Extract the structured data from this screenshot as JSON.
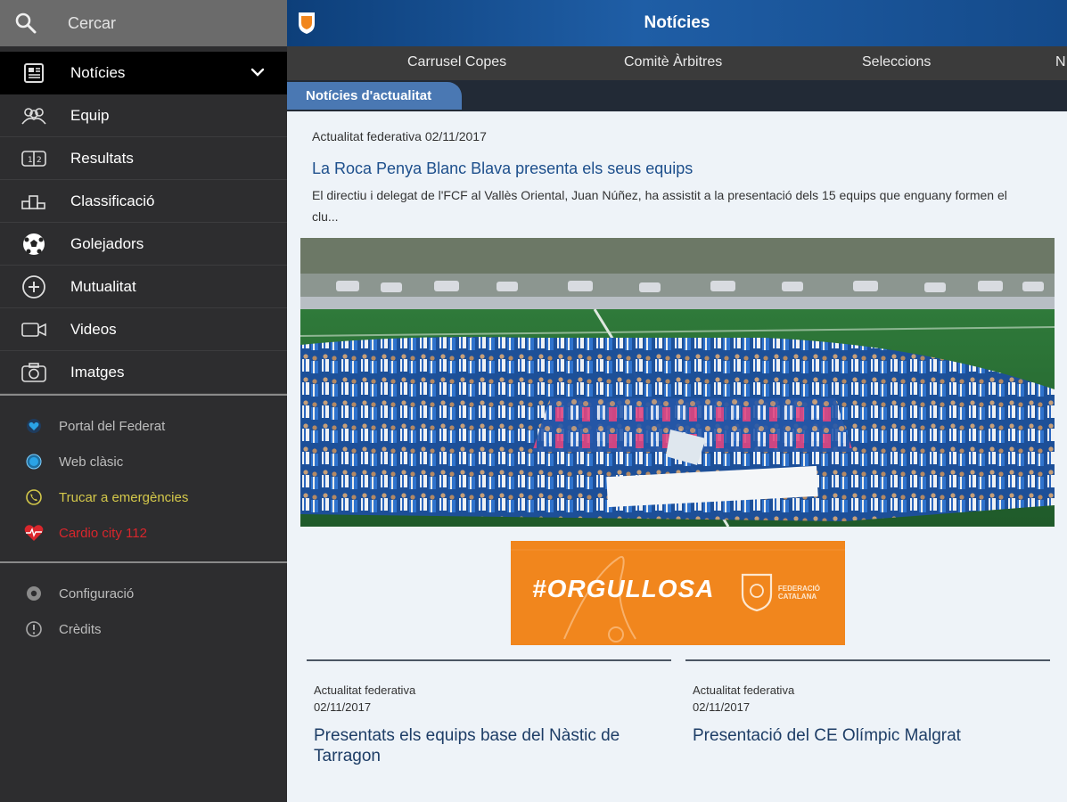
{
  "search": {
    "label": "Cercar"
  },
  "nav": {
    "items": [
      {
        "label": "Notícies",
        "icon": "newspaper-icon",
        "active": true
      },
      {
        "label": "Equip",
        "icon": "team-icon"
      },
      {
        "label": "Resultats",
        "icon": "scoreboard-icon"
      },
      {
        "label": "Classificació",
        "icon": "podium-icon"
      },
      {
        "label": "Golejadors",
        "icon": "soccer-ball-icon"
      },
      {
        "label": "Mutualitat",
        "icon": "plus-circle-icon"
      },
      {
        "label": "Videos",
        "icon": "video-camera-icon"
      },
      {
        "label": "Imatges",
        "icon": "camera-icon"
      }
    ]
  },
  "links": [
    {
      "label": "Portal del Federat",
      "icon": "heart-globe-icon",
      "color": "#2aa3e6"
    },
    {
      "label": "Web clàsic",
      "icon": "globe-icon",
      "color": "#2aa3e6"
    },
    {
      "label": "Trucar a emergències",
      "icon": "phone-icon",
      "color": "#d4c84a"
    },
    {
      "label": "Cardio city 112",
      "icon": "heart-pulse-icon",
      "color": "#d9262c"
    }
  ],
  "settings": [
    {
      "label": "Configuració",
      "icon": "gear-icon"
    },
    {
      "label": "Crèdits",
      "icon": "info-icon"
    }
  ],
  "header": {
    "title": "Notícies"
  },
  "tabs": [
    {
      "label": "Carrusel Copes"
    },
    {
      "label": "Comitè Àrbitres"
    },
    {
      "label": "Seleccions"
    },
    {
      "label": "N"
    }
  ],
  "subtab": {
    "label": "Notícies d'actualitat"
  },
  "featured": {
    "meta": "Actualitat federativa 02/11/2017",
    "title": "La Roca Penya Blanc Blava presenta els seus equips",
    "summary": "El directiu i delegat de l'FCF al Vallès Oriental, Juan Núñez, ha assistit a la presentació dels 15 equips que enguany formen el clu..."
  },
  "banner": {
    "hashtag": "#ORGULLOSA",
    "org_line1": "FEDERACIÓ",
    "org_line2": "CATALANA"
  },
  "cards": [
    {
      "category": "Actualitat federativa",
      "date": "02/11/2017",
      "title": "Presentats els equips base del Nàstic de Tarragon"
    },
    {
      "category": "Actualitat federativa",
      "date": "02/11/2017",
      "title": "Presentació del CE Olímpic Malgrat"
    }
  ],
  "colors": {
    "accent": "#1f5ea6",
    "sidebar": "#2d2d2f",
    "banner": "#f1861d"
  }
}
